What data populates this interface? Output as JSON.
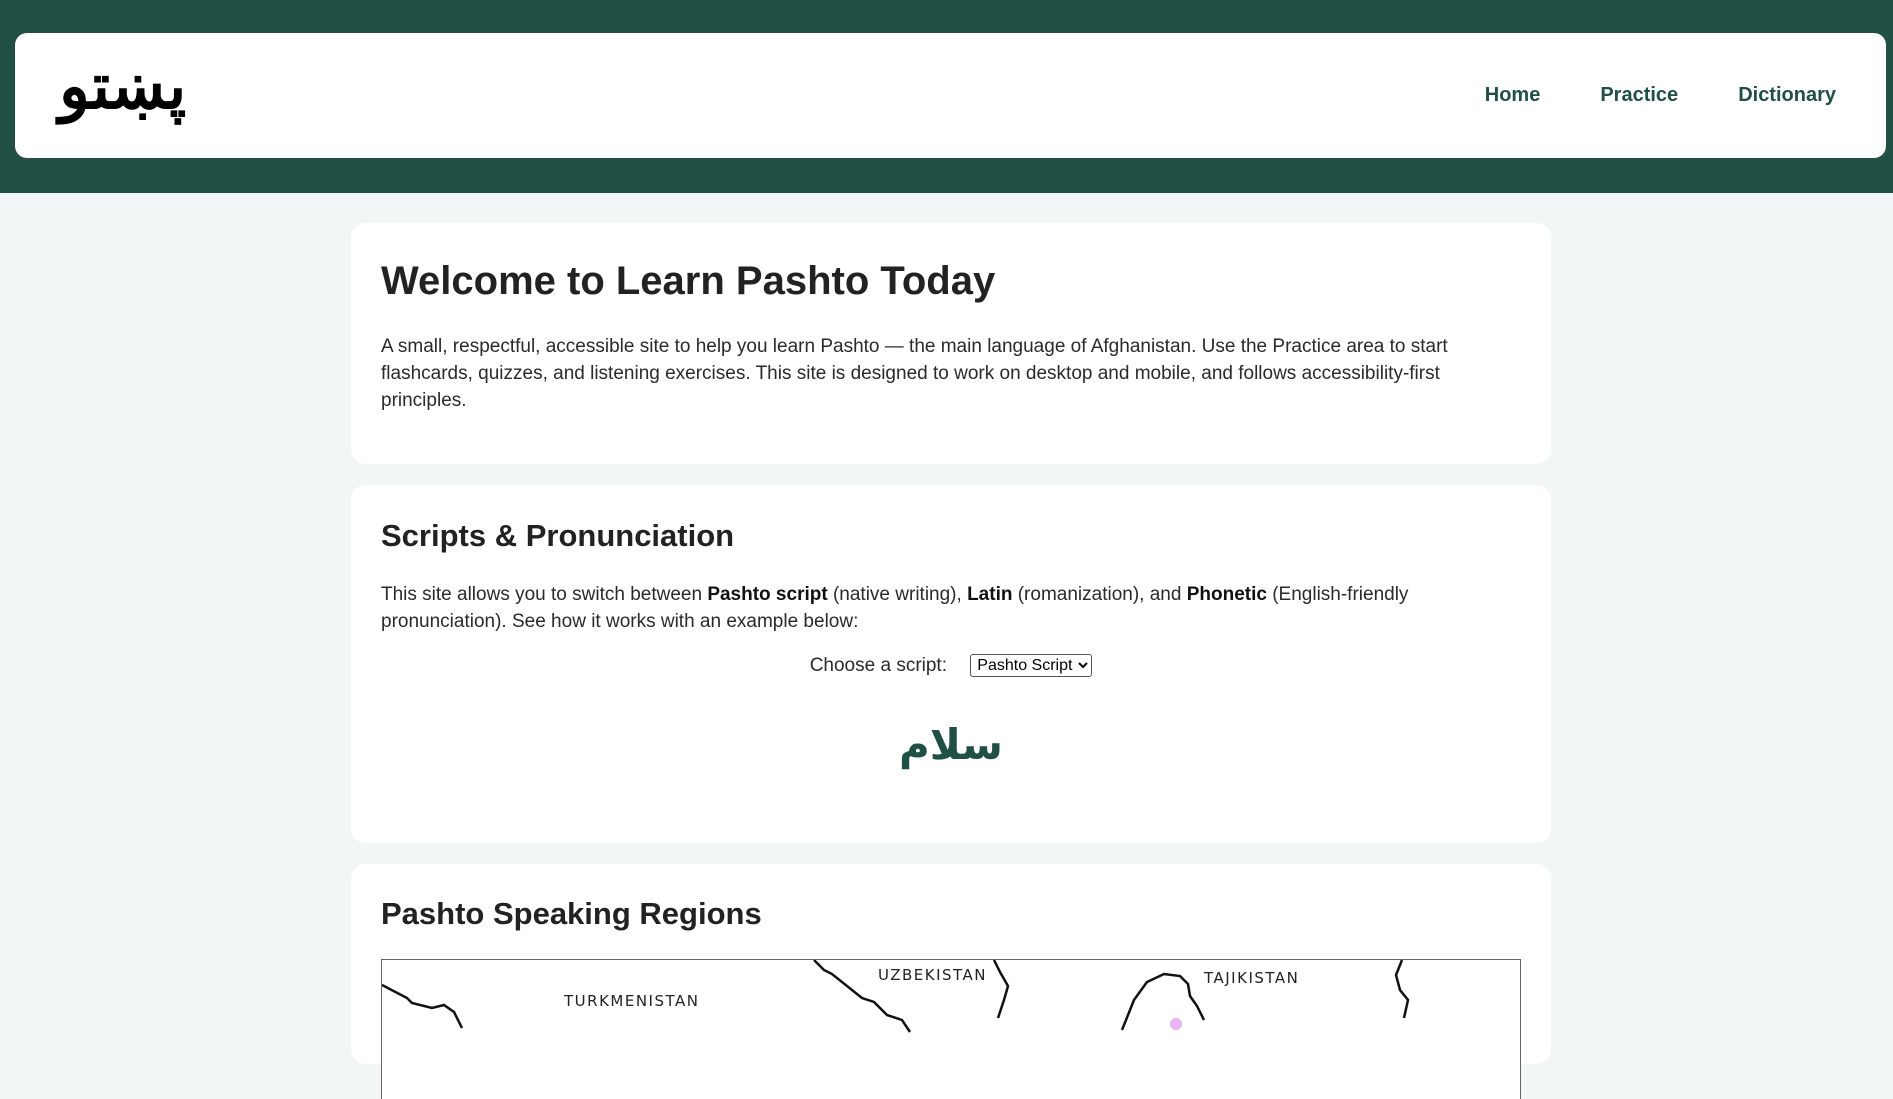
{
  "header": {
    "logo_text": "پښتو",
    "nav": [
      {
        "label": "Home"
      },
      {
        "label": "Practice"
      },
      {
        "label": "Dictionary"
      }
    ]
  },
  "welcome": {
    "title": "Welcome to Learn Pashto Today",
    "text": "A small, respectful, accessible site to help you learn Pashto — the main language of Afghanistan. Use the Practice area to start flashcards, quizzes, and listening exercises. This site is designed to work on desktop and mobile, and follows accessibility-first principles."
  },
  "scripts": {
    "title": "Scripts & Pronunciation",
    "desc_part1": "This site allows you to switch between ",
    "bold1": "Pashto script",
    "desc_part2": " (native writing), ",
    "bold2": "Latin",
    "desc_part3": " (romanization), and ",
    "bold3": "Phonetic",
    "desc_part4": " (English-friendly pronunciation). See how it works with an example below:",
    "choose_label": "Choose a script:",
    "selected_option": "Pashto Script",
    "example_word": "سلام"
  },
  "regions": {
    "title": "Pashto Speaking Regions",
    "map_labels": [
      "TURKMENISTAN",
      "UZBEKISTAN",
      "TAJIKISTAN"
    ]
  },
  "colors": {
    "brand": "#214f45",
    "background": "#f3f6f6"
  }
}
